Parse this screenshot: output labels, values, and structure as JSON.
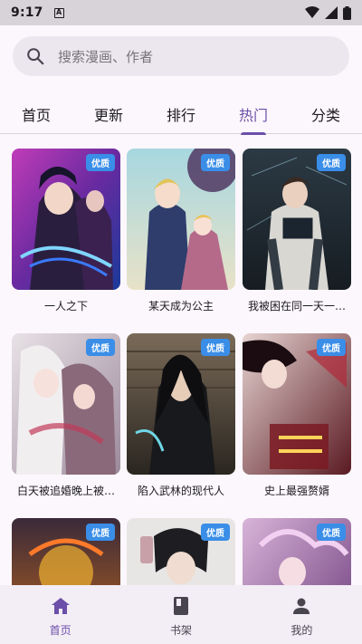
{
  "status_bar": {
    "time": "9:17",
    "notification_glyph": "A"
  },
  "search": {
    "placeholder": "搜索漫画、作者"
  },
  "tabs": [
    {
      "label": "首页",
      "active": false
    },
    {
      "label": "更新",
      "active": false
    },
    {
      "label": "排行",
      "active": false
    },
    {
      "label": "热门",
      "active": true
    },
    {
      "label": "分类",
      "active": false
    }
  ],
  "comics": [
    {
      "title": "一人之下",
      "badge": "优质"
    },
    {
      "title": "某天成为公主",
      "badge": "优质"
    },
    {
      "title": "我被困在同一天一…",
      "badge": "优质"
    },
    {
      "title": "白天被追婚晚上被…",
      "badge": "优质"
    },
    {
      "title": "陷入武林的现代人",
      "badge": "优质"
    },
    {
      "title": "史上最强赘婿",
      "badge": "优质"
    },
    {
      "title": "",
      "badge": "优质"
    },
    {
      "title": "",
      "badge": "优质"
    },
    {
      "title": "",
      "badge": "优质"
    }
  ],
  "bottom_nav": [
    {
      "label": "首页",
      "icon": "home-icon",
      "active": true
    },
    {
      "label": "书架",
      "icon": "book-icon",
      "active": false
    },
    {
      "label": "我的",
      "icon": "person-icon",
      "active": false
    }
  ],
  "colors": {
    "accent": "#6b4fa8",
    "badge": "#3a8ee8",
    "background": "#fcf7fc"
  }
}
